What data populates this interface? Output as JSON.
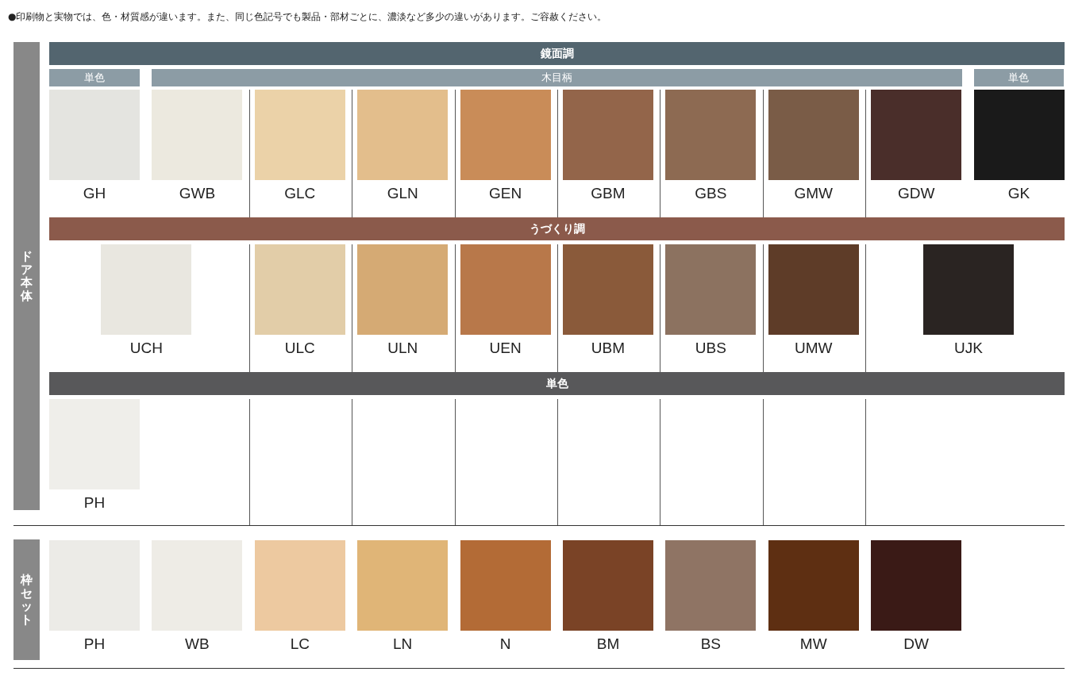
{
  "notice": "●印刷物と実物では、色・材質感が違います。また、同じ色記号でも製品・部材ごとに、濃淡など多少の違いがあります。ご容赦ください。",
  "door": {
    "label": "ドア本体",
    "groups": [
      {
        "kind": "gloss",
        "title": "鏡面調",
        "subgroups": [
          {
            "title": "単色",
            "swatches": [
              {
                "code": "GH",
                "color": "#e4e4e0"
              }
            ]
          },
          {
            "title": "木目柄",
            "swatches": [
              {
                "code": "GWB",
                "color": "#ece9df"
              },
              {
                "code": "GLC",
                "color": "#ebd2a8"
              },
              {
                "code": "GLN",
                "color": "#e3be8c"
              },
              {
                "code": "GEN",
                "color": "#c98c58"
              },
              {
                "code": "GBM",
                "color": "#93654a"
              },
              {
                "code": "GBS",
                "color": "#8d6a52"
              },
              {
                "code": "GMW",
                "color": "#7a5c47"
              },
              {
                "code": "GDW",
                "color": "#4a2e2a"
              }
            ]
          },
          {
            "title": "単色",
            "swatches": [
              {
                "code": "GK",
                "color": "#1a1a1a"
              }
            ]
          }
        ]
      },
      {
        "kind": "grain",
        "title": "うづくり調",
        "swatches": [
          {
            "code": "UCH",
            "color": "#e9e7e0",
            "kind": "wide"
          },
          {
            "code": "ULC",
            "color": "#e2cda8",
            "kind": "normal"
          },
          {
            "code": "ULN",
            "color": "#d5aa74",
            "kind": "normal"
          },
          {
            "code": "UEN",
            "color": "#b8784a",
            "kind": "normal"
          },
          {
            "code": "UBM",
            "color": "#8a5a3a",
            "kind": "normal"
          },
          {
            "code": "UBS",
            "color": "#8c7260",
            "kind": "normal"
          },
          {
            "code": "UMW",
            "color": "#5e3c28",
            "kind": "normal"
          },
          {
            "code": "UJK",
            "color": "#2a2422",
            "kind": "wide"
          }
        ]
      },
      {
        "kind": "solid",
        "title": "単色",
        "swatches": [
          {
            "code": "PH",
            "color": "#efeeea",
            "kind": "normal"
          }
        ]
      }
    ]
  },
  "frame": {
    "label": "枠セット",
    "swatches": [
      {
        "code": "PH",
        "color": "#ecebe7"
      },
      {
        "code": "WB",
        "color": "#eeece6"
      },
      {
        "code": "LC",
        "color": "#edc9a0"
      },
      {
        "code": "LN",
        "color": "#e0b577"
      },
      {
        "code": "N",
        "color": "#b36b36"
      },
      {
        "code": "BM",
        "color": "#7a4326"
      },
      {
        "code": "BS",
        "color": "#8f7464"
      },
      {
        "code": "MW",
        "color": "#5e2f12"
      },
      {
        "code": "DW",
        "color": "#3a1a16"
      }
    ]
  }
}
